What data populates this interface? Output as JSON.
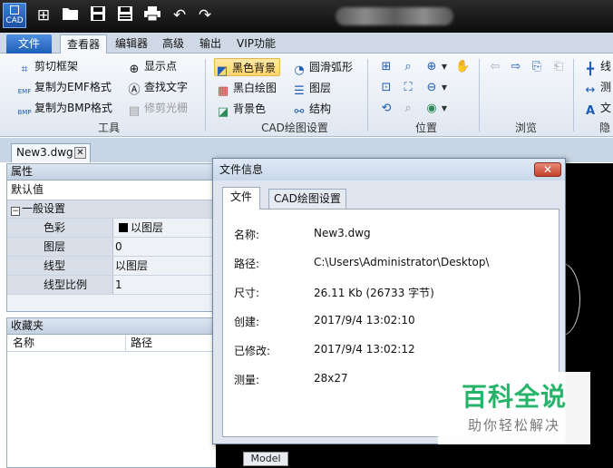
{
  "titlebar": {
    "logo_text": "CAD",
    "quick_icons": [
      "new-icon",
      "open-folder-icon",
      "save-icon",
      "save-as-icon",
      "print-icon",
      "undo-icon",
      "redo-icon"
    ]
  },
  "menu": {
    "tabs": [
      "文件",
      "查看器",
      "编辑器",
      "高级",
      "输出",
      "VIP功能"
    ],
    "active": "查看器"
  },
  "ribbon": {
    "tools": {
      "items": [
        "剪切框架",
        "复制为EMF格式",
        "复制为BMP格式",
        "显示点",
        "查找文字",
        "修剪光栅"
      ],
      "label": "工具"
    },
    "cad": {
      "items": [
        "黑色背景",
        "黑白绘图",
        "背景色",
        "圆滑弧形",
        "图层",
        "结构"
      ],
      "label": "CAD绘图设置"
    },
    "position": {
      "label": "位置"
    },
    "browse": {
      "label": "浏览"
    },
    "cut": {
      "items": [
        "线",
        "测",
        "文"
      ],
      "label": "隐"
    }
  },
  "document": {
    "tab_label": "New3.dwg"
  },
  "properties": {
    "title": "属性",
    "default_value": "默认值",
    "group": "一般设置",
    "group_toggle": "−",
    "rows": [
      {
        "name": "色彩",
        "value": "以图层"
      },
      {
        "name": "图层",
        "value": "0"
      },
      {
        "name": "线型",
        "value": "以图层"
      },
      {
        "name": "线型比例",
        "value": "1"
      }
    ]
  },
  "favorites": {
    "title": "收藏夹",
    "pin": "⊓",
    "columns": [
      "名称",
      "路径"
    ]
  },
  "canvas": {
    "model_tab": "Model"
  },
  "dialog": {
    "title": "文件信息",
    "close": "✕",
    "tabs": [
      "文件",
      "CAD绘图设置"
    ],
    "rows": [
      {
        "key": "名称:",
        "value": "New3.dwg"
      },
      {
        "key": "路径:",
        "value": "C:\\Users\\Administrator\\Desktop\\"
      },
      {
        "key": "尺寸:",
        "value": "26.11 Kb (26733 字节)"
      },
      {
        "key": "创建:",
        "value": "2017/9/4 13:02:10"
      },
      {
        "key": "已修改:",
        "value": "2017/9/4 13:02:12"
      },
      {
        "key": "测量:",
        "value": "28x27"
      }
    ]
  },
  "watermark": {
    "main": "百科全说",
    "sub": "助你轻松解决"
  },
  "colors": {
    "accent_blue": "#1e5fb8",
    "active_button": "#ffd56b",
    "watermark_green": "#27b36a",
    "canvas": "#000000"
  }
}
